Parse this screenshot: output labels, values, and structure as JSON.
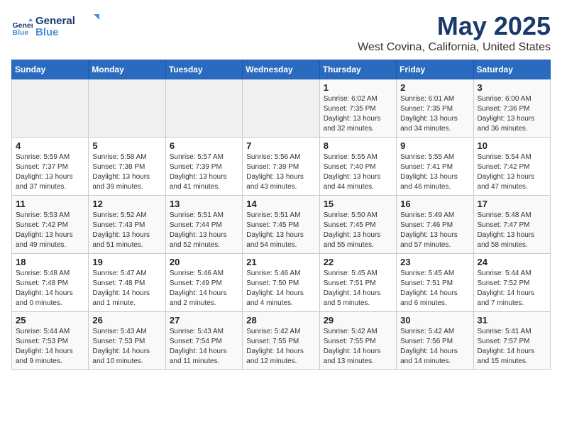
{
  "logo": {
    "line1": "General",
    "line2": "Blue"
  },
  "title": "May 2025",
  "subtitle": "West Covina, California, United States",
  "header": {
    "days": [
      "Sunday",
      "Monday",
      "Tuesday",
      "Wednesday",
      "Thursday",
      "Friday",
      "Saturday"
    ]
  },
  "weeks": [
    {
      "days": [
        {
          "num": "",
          "info": ""
        },
        {
          "num": "",
          "info": ""
        },
        {
          "num": "",
          "info": ""
        },
        {
          "num": "",
          "info": ""
        },
        {
          "num": "1",
          "info": "Sunrise: 6:02 AM\nSunset: 7:35 PM\nDaylight: 13 hours\nand 32 minutes."
        },
        {
          "num": "2",
          "info": "Sunrise: 6:01 AM\nSunset: 7:35 PM\nDaylight: 13 hours\nand 34 minutes."
        },
        {
          "num": "3",
          "info": "Sunrise: 6:00 AM\nSunset: 7:36 PM\nDaylight: 13 hours\nand 36 minutes."
        }
      ]
    },
    {
      "days": [
        {
          "num": "4",
          "info": "Sunrise: 5:59 AM\nSunset: 7:37 PM\nDaylight: 13 hours\nand 37 minutes."
        },
        {
          "num": "5",
          "info": "Sunrise: 5:58 AM\nSunset: 7:38 PM\nDaylight: 13 hours\nand 39 minutes."
        },
        {
          "num": "6",
          "info": "Sunrise: 5:57 AM\nSunset: 7:39 PM\nDaylight: 13 hours\nand 41 minutes."
        },
        {
          "num": "7",
          "info": "Sunrise: 5:56 AM\nSunset: 7:39 PM\nDaylight: 13 hours\nand 43 minutes."
        },
        {
          "num": "8",
          "info": "Sunrise: 5:55 AM\nSunset: 7:40 PM\nDaylight: 13 hours\nand 44 minutes."
        },
        {
          "num": "9",
          "info": "Sunrise: 5:55 AM\nSunset: 7:41 PM\nDaylight: 13 hours\nand 46 minutes."
        },
        {
          "num": "10",
          "info": "Sunrise: 5:54 AM\nSunset: 7:42 PM\nDaylight: 13 hours\nand 47 minutes."
        }
      ]
    },
    {
      "days": [
        {
          "num": "11",
          "info": "Sunrise: 5:53 AM\nSunset: 7:42 PM\nDaylight: 13 hours\nand 49 minutes."
        },
        {
          "num": "12",
          "info": "Sunrise: 5:52 AM\nSunset: 7:43 PM\nDaylight: 13 hours\nand 51 minutes."
        },
        {
          "num": "13",
          "info": "Sunrise: 5:51 AM\nSunset: 7:44 PM\nDaylight: 13 hours\nand 52 minutes."
        },
        {
          "num": "14",
          "info": "Sunrise: 5:51 AM\nSunset: 7:45 PM\nDaylight: 13 hours\nand 54 minutes."
        },
        {
          "num": "15",
          "info": "Sunrise: 5:50 AM\nSunset: 7:45 PM\nDaylight: 13 hours\nand 55 minutes."
        },
        {
          "num": "16",
          "info": "Sunrise: 5:49 AM\nSunset: 7:46 PM\nDaylight: 13 hours\nand 57 minutes."
        },
        {
          "num": "17",
          "info": "Sunrise: 5:48 AM\nSunset: 7:47 PM\nDaylight: 13 hours\nand 58 minutes."
        }
      ]
    },
    {
      "days": [
        {
          "num": "18",
          "info": "Sunrise: 5:48 AM\nSunset: 7:48 PM\nDaylight: 14 hours\nand 0 minutes."
        },
        {
          "num": "19",
          "info": "Sunrise: 5:47 AM\nSunset: 7:48 PM\nDaylight: 14 hours\nand 1 minute."
        },
        {
          "num": "20",
          "info": "Sunrise: 5:46 AM\nSunset: 7:49 PM\nDaylight: 14 hours\nand 2 minutes."
        },
        {
          "num": "21",
          "info": "Sunrise: 5:46 AM\nSunset: 7:50 PM\nDaylight: 14 hours\nand 4 minutes."
        },
        {
          "num": "22",
          "info": "Sunrise: 5:45 AM\nSunset: 7:51 PM\nDaylight: 14 hours\nand 5 minutes."
        },
        {
          "num": "23",
          "info": "Sunrise: 5:45 AM\nSunset: 7:51 PM\nDaylight: 14 hours\nand 6 minutes."
        },
        {
          "num": "24",
          "info": "Sunrise: 5:44 AM\nSunset: 7:52 PM\nDaylight: 14 hours\nand 7 minutes."
        }
      ]
    },
    {
      "days": [
        {
          "num": "25",
          "info": "Sunrise: 5:44 AM\nSunset: 7:53 PM\nDaylight: 14 hours\nand 9 minutes."
        },
        {
          "num": "26",
          "info": "Sunrise: 5:43 AM\nSunset: 7:53 PM\nDaylight: 14 hours\nand 10 minutes."
        },
        {
          "num": "27",
          "info": "Sunrise: 5:43 AM\nSunset: 7:54 PM\nDaylight: 14 hours\nand 11 minutes."
        },
        {
          "num": "28",
          "info": "Sunrise: 5:42 AM\nSunset: 7:55 PM\nDaylight: 14 hours\nand 12 minutes."
        },
        {
          "num": "29",
          "info": "Sunrise: 5:42 AM\nSunset: 7:55 PM\nDaylight: 14 hours\nand 13 minutes."
        },
        {
          "num": "30",
          "info": "Sunrise: 5:42 AM\nSunset: 7:56 PM\nDaylight: 14 hours\nand 14 minutes."
        },
        {
          "num": "31",
          "info": "Sunrise: 5:41 AM\nSunset: 7:57 PM\nDaylight: 14 hours\nand 15 minutes."
        }
      ]
    }
  ]
}
